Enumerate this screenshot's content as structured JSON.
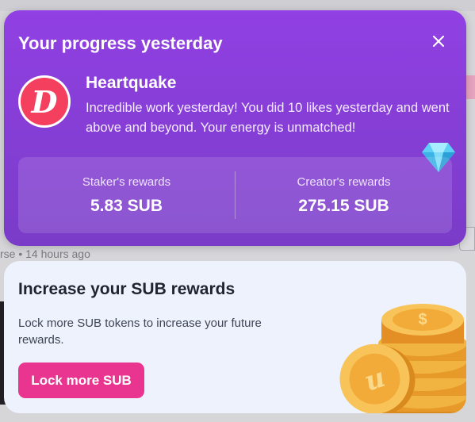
{
  "background": {
    "meta_text": "rse • 14 hours ago"
  },
  "progress_card": {
    "title": "Your progress yesterday",
    "close_icon": "close-icon",
    "creator": {
      "avatar_letter": "D",
      "name": "Heartquake",
      "message": "Incredible work yesterday! You did 10 likes yesterday and went above and beyond. Your energy is unmatched!"
    },
    "rewards": {
      "staker_label": "Staker's rewards",
      "staker_value": "5.83 SUB",
      "creator_label": "Creator's rewards",
      "creator_value": "275.15 SUB"
    },
    "colors": {
      "card_top": "#9140e3",
      "card_bottom": "#7a3cc8",
      "avatar": "#f43f5e"
    }
  },
  "increase_card": {
    "title": "Increase your SUB rewards",
    "description": "Lock more SUB tokens to increase your future rewards.",
    "button_label": "Lock more SUB",
    "colors": {
      "background": "#eef2fc",
      "button": "#e9358f",
      "coin": "#f5b73d"
    }
  }
}
